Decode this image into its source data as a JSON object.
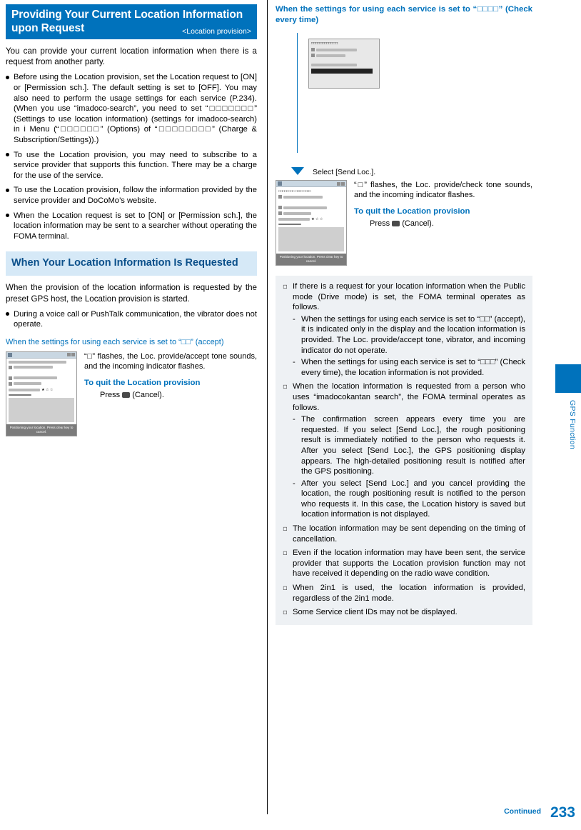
{
  "header": {
    "title": "Providing Your Current Location Information upon Request",
    "subtitle": "<Location provision>"
  },
  "left": {
    "intro": "You can provide your current location information when there is a request from another party.",
    "bullets": [
      "Before using the Location provision, set the Location request to [ON] or [Permission sch.]. The default setting is set to [OFF]. You may also need to perform the usage settings for each service (P.234). (When you use “imadoco-search”, you need to set “□□□□□□□” (Settings to use location information) (settings for imadoco-search) in i Menu (“□□□□□□” (Options) of “□□□□□□□□” (Charge & Subscription/Settings)).)",
      "To use the Location provision, you may need to subscribe to a service provider that supports this function. There may be a charge for the use of the service.",
      "To use the Location provision, follow the information provided by the service provider and DoCoMo’s website.",
      "When the Location request is set to [ON] or [Permission sch.], the location information may be sent to a searcher without operating the FOMA terminal."
    ],
    "section_header": "When Your Location Information Is Requested",
    "paragraph": "When the provision of the location information is requested by the preset GPS host, the Location provision is started.",
    "bullet2": "During a voice call or PushTalk communication, the vibrator does not operate.",
    "caption": "When the settings for using each service is set to “□□” (accept)",
    "note_1": "“□” flashes, the Loc. provide/accept tone sounds, and the incoming indicator flashes.",
    "quit_title": "To quit the Location provision",
    "quit_press": "Press",
    "quit_press_tail": "(Cancel).",
    "phone_footer": "Positioning your location.\nPress clear key to cancel.",
    "phone_title": "□□□□□□□□ □□□□□□□□",
    "phone_stars": "★ ☆ ☆"
  },
  "right": {
    "caption": "When the settings for using each service is set to “□□□□” (Check every time)",
    "step_label": "Select [Send Loc.].",
    "note_1": "“□” flashes, the Loc. provide/check tone sounds, and the incoming indicator flashes.",
    "quit_title": "To quit the Location provision",
    "quit_press": "Press",
    "quit_press_tail": "(Cancel).",
    "phone_top_label": "□□□□□□□□□□□□:",
    "phone_footer": "Positioning your location.\nPress clear key to cancel.",
    "phone_title": "□□□□□□□□ □□□□□□□□",
    "phone_stars": "★ ☆ ☆",
    "notes": [
      {
        "text": "If there is a request for your location information when the Public mode (Drive mode) is set, the FOMA terminal operates as follows.",
        "sub": [
          "When the settings for using each service is set to “□□” (accept), it is indicated only in the display and the location information is provided. The Loc. provide/accept tone, vibrator, and incoming indicator do not operate.",
          "When the settings for using each service is set to “□□□” (Check every time), the location information is not provided."
        ]
      },
      {
        "text": "When the location information is requested from a person who uses “imadocokantan search”, the FOMA terminal operates as follows.",
        "sub": [
          "The confirmation screen appears every time you are requested. If you select [Send Loc.], the rough positioning result is immediately notified to the person who requests it. After you select [Send Loc.], the GPS positioning display appears. The high-detailed positioning result is notified after the GPS positioning.",
          "After you select [Send Loc.] and you cancel providing the location, the rough positioning result is notified to the person who requests it. In this case, the Location history is saved but location information is not displayed."
        ]
      },
      {
        "text": "The location information may be sent depending on the timing of cancellation.",
        "sub": []
      },
      {
        "text": "Even if the location information may have been sent, the service provider that supports the Location provision function may not have received it depending on the radio wave condition.",
        "sub": []
      },
      {
        "text": "When 2in1 is used, the location information is provided, regardless of the 2in1 mode.",
        "sub": []
      },
      {
        "text": "Some Service client IDs may not be displayed.",
        "sub": []
      }
    ]
  },
  "sidetab": {
    "label": "GPS Function"
  },
  "footer": {
    "continued": "Continued",
    "page": "233"
  },
  "colors": {
    "accent": "#0072bc",
    "panel": "#eef1f4",
    "subheader_bg": "#d6e9f7"
  }
}
